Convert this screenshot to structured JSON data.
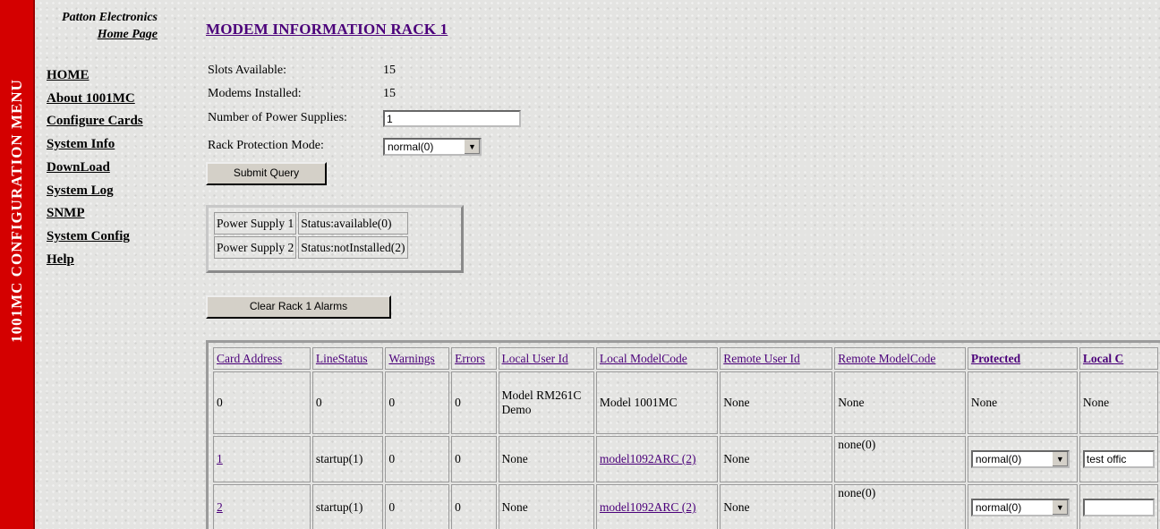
{
  "banner": {
    "text": "1001MC CONFIGURATION MENU"
  },
  "brand": {
    "line1": "Patton Electronics",
    "line2": "Home Page"
  },
  "nav": {
    "items": [
      {
        "label": "HOME"
      },
      {
        "label": "About 1001MC"
      },
      {
        "label": "Configure Cards"
      },
      {
        "label": "System Info"
      },
      {
        "label": "DownLoad"
      },
      {
        "label": "System Log"
      },
      {
        "label": "SNMP"
      },
      {
        "label": "System Config"
      },
      {
        "label": "Help"
      }
    ]
  },
  "page": {
    "title": "MODEM INFORMATION RACK 1"
  },
  "info": {
    "slots_label": "Slots Available:",
    "slots_value": "15",
    "modems_label": "Modems Installed:",
    "modems_value": "15",
    "power_label": "Number of Power Supplies:",
    "power_value": "1",
    "protection_label": "Rack Protection Mode:",
    "protection_value": "normal(0)"
  },
  "buttons": {
    "submit": "Submit Query",
    "clear_alarms": "Clear Rack 1 Alarms"
  },
  "power_supplies": [
    {
      "name": "Power Supply 1",
      "status": "Status:available(0)"
    },
    {
      "name": "Power Supply 2",
      "status": "Status:notInstalled(2)"
    }
  ],
  "modem_table": {
    "headers": [
      "Card Address",
      "LineStatus",
      "Warnings",
      "Errors",
      "Local User Id",
      "Local ModelCode",
      "Remote User Id",
      "Remote ModelCode",
      "Protected",
      "Local C"
    ],
    "rows": [
      {
        "address": "0",
        "line_status": "0",
        "warnings": "0",
        "errors": "0",
        "local_user_id": "Model RM261C Demo",
        "local_model": "Model 1001MC",
        "remote_user_id": "None",
        "remote_model": "None",
        "protected": "None",
        "local_c": "None"
      },
      {
        "address": "1",
        "line_status": "startup(1)",
        "warnings": "0",
        "errors": "0",
        "local_user_id": "None",
        "local_model": "model1092ARC (2)",
        "remote_user_id": "None",
        "remote_model": "none(0)",
        "protected": "normal(0)",
        "local_c": "test offic"
      },
      {
        "address": "2",
        "line_status": "startup(1)",
        "warnings": "0",
        "errors": "0",
        "local_user_id": "None",
        "local_model": "model1092ARC (2)",
        "remote_user_id": "None",
        "remote_model": "none(0)",
        "protected": "normal(0)",
        "local_c": ""
      }
    ]
  }
}
